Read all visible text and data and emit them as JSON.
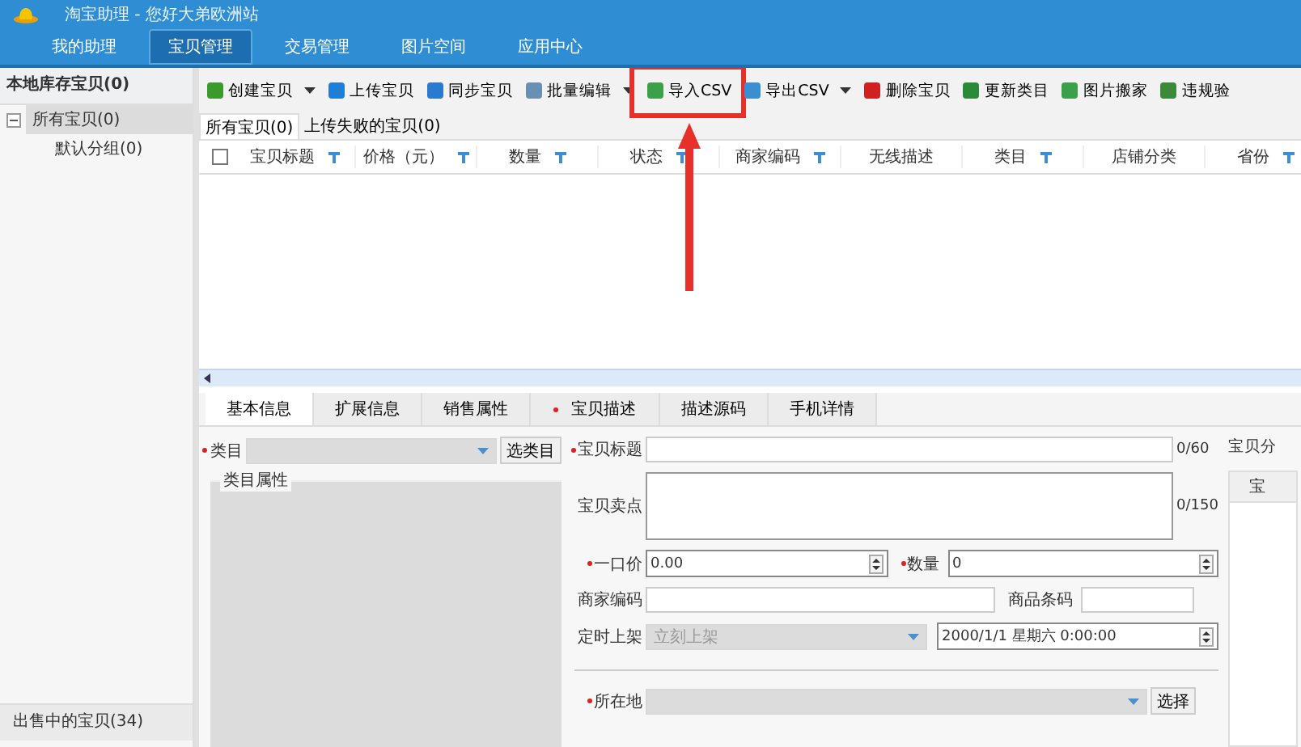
{
  "window": {
    "title": "淘宝助理 - 您好大弟欧洲站"
  },
  "nav_tabs": [
    {
      "label": "我的助理",
      "selected": false
    },
    {
      "label": "宝贝管理",
      "selected": true
    },
    {
      "label": "交易管理",
      "selected": false
    },
    {
      "label": "图片空间",
      "selected": false
    },
    {
      "label": "应用中心",
      "selected": false
    }
  ],
  "sidebar": {
    "header": "本地库存宝贝(0)",
    "items": [
      {
        "label": "所有宝贝(0)",
        "selected": true,
        "expanded": true,
        "children": [
          {
            "label": "默认分组(0)",
            "selected": false
          }
        ]
      }
    ],
    "footer": "出售中的宝贝(34)"
  },
  "toolbar": [
    {
      "label": "创建宝贝",
      "dropdown": true,
      "highlight": false
    },
    {
      "label": "上传宝贝",
      "dropdown": false,
      "highlight": false
    },
    {
      "label": "同步宝贝",
      "dropdown": false,
      "highlight": false
    },
    {
      "label": "批量编辑",
      "dropdown": true,
      "highlight": false
    },
    {
      "label": "导入CSV",
      "dropdown": false,
      "highlight": true
    },
    {
      "label": "导出CSV",
      "dropdown": true,
      "highlight": false
    },
    {
      "label": "删除宝贝",
      "dropdown": false,
      "highlight": false
    },
    {
      "label": "更新类目",
      "dropdown": false,
      "highlight": false
    },
    {
      "label": "图片搬家",
      "dropdown": false,
      "highlight": false
    },
    {
      "label": "违规验",
      "dropdown": false,
      "highlight": false
    }
  ],
  "list_tabs": [
    {
      "label": "所有宝贝(0)",
      "selected": true
    },
    {
      "label": "上传失败的宝贝(0)",
      "selected": false
    }
  ],
  "table": {
    "select_all_checked": false,
    "columns": [
      {
        "label": "宝贝标题",
        "filter": true
      },
      {
        "label": "价格（元）",
        "filter": true
      },
      {
        "label": "数量",
        "filter": true
      },
      {
        "label": "状态",
        "filter": true
      },
      {
        "label": "商家编码",
        "filter": true
      },
      {
        "label": "无线描述",
        "filter": false
      },
      {
        "label": "类目",
        "filter": true
      },
      {
        "label": "店铺分类",
        "filter": false
      },
      {
        "label": "省份",
        "filter": true
      }
    ]
  },
  "detail_tabs": [
    {
      "label": "基本信息",
      "selected": true,
      "required": false
    },
    {
      "label": "扩展信息",
      "selected": false,
      "required": false
    },
    {
      "label": "销售属性",
      "selected": false,
      "required": false
    },
    {
      "label": "宝贝描述",
      "selected": false,
      "required": true
    },
    {
      "label": "描述源码",
      "selected": false,
      "required": false
    },
    {
      "label": "手机详情",
      "selected": false,
      "required": false
    }
  ],
  "form": {
    "category": {
      "label": "类目",
      "required": true,
      "button": "选类目"
    },
    "category_props": {
      "title": "类目属性"
    },
    "item_title": {
      "label": "宝贝标题",
      "required": true,
      "counter": "0/60"
    },
    "selling_points": {
      "label": "宝贝卖点",
      "required": false,
      "counter": "0/150"
    },
    "price": {
      "label": "一口价",
      "required": true,
      "value": "0.00"
    },
    "quantity": {
      "label": "数量",
      "required": true,
      "value": "0"
    },
    "merchant_code": {
      "label": "商家编码",
      "required": false
    },
    "barcode": {
      "label": "商品条码",
      "required": false
    },
    "scheduled": {
      "label": "定时上架",
      "required": false,
      "value": "立刻上架",
      "disabled": true,
      "datetime": "2000/1/1 星期六 0:00:00"
    },
    "location": {
      "label": "所在地",
      "required": true,
      "button": "选择"
    },
    "side_label": "宝贝分",
    "side_header": "宝"
  }
}
